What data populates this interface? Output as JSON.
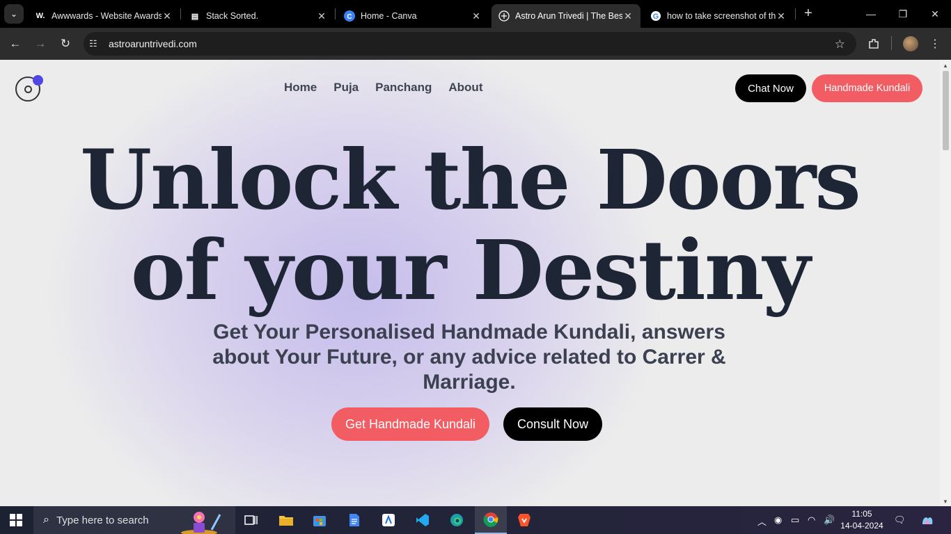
{
  "browser": {
    "tabs": [
      {
        "title": "Awwwards - Website Awards",
        "favicon": "W."
      },
      {
        "title": "Stack Sorted.",
        "favicon": "stack-sorted-icon"
      },
      {
        "title": "Home - Canva",
        "favicon": "canva-icon"
      },
      {
        "title": "Astro Arun Trivedi | The Best",
        "favicon": "astro-icon"
      },
      {
        "title": "how to take screenshot of the",
        "favicon": "google-icon"
      }
    ],
    "url": "astroaruntrivedi.com"
  },
  "site": {
    "nav": [
      "Home",
      "Puja",
      "Panchang",
      "About"
    ],
    "chat_label": "Chat Now",
    "kundali_label": "Handmade Kundali",
    "hero_title_line1": "Unlock the Doors",
    "hero_title_line2": "of your Destiny",
    "hero_subtitle": "Get Your Personalised Handmade Kundali, answers about Your Future, or any advice related to Carrer & Marriage.",
    "cta_primary": "Get Handmade Kundali",
    "cta_secondary": "Consult Now",
    "colors": {
      "accent": "#f25c63",
      "dark": "#000000",
      "logo_dot": "#4f46e5",
      "heading": "#1e2636"
    }
  },
  "taskbar": {
    "search_placeholder": "Type here to search",
    "time": "11:05",
    "date": "14-04-2024"
  }
}
